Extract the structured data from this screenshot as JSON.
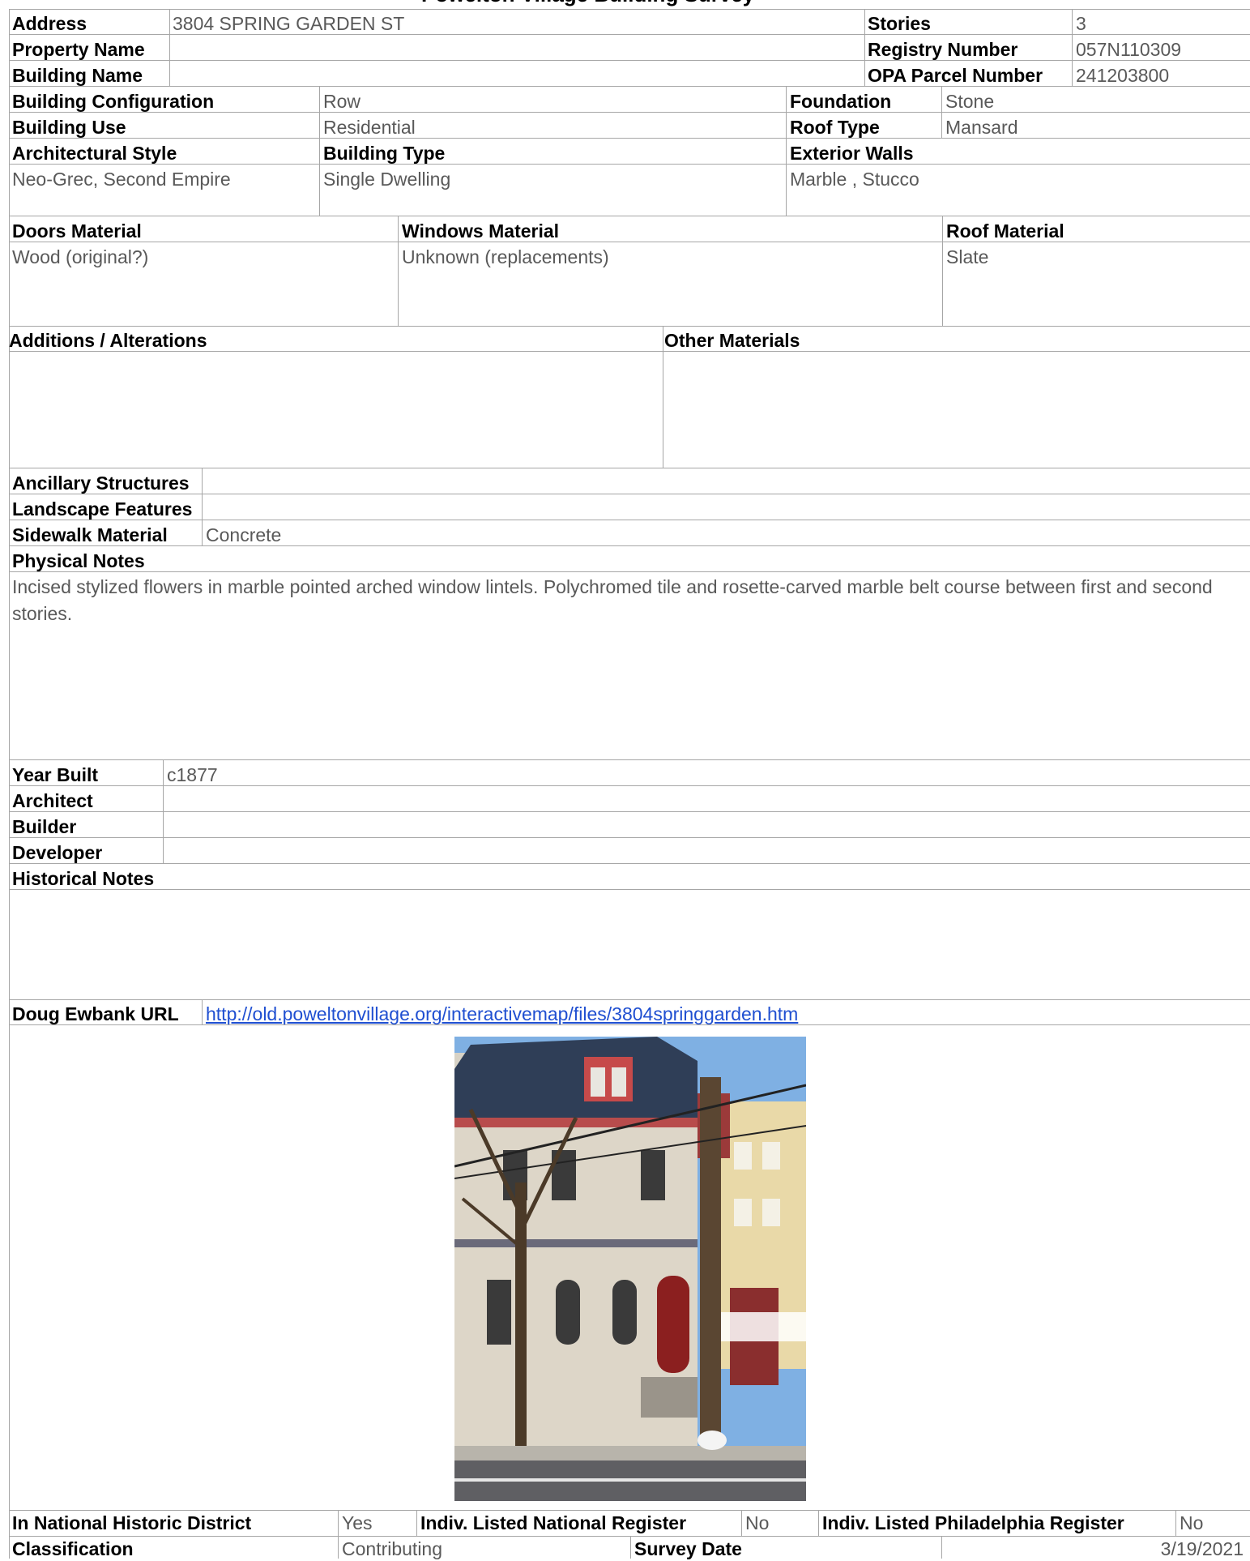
{
  "header": {
    "title": "Powelton Village Building Survey"
  },
  "property": {
    "address_label": "Address",
    "address": "3804 SPRING GARDEN ST",
    "property_name_label": "Property Name",
    "property_name": "",
    "building_name_label": "Building Name",
    "building_name": "",
    "stories_label": "Stories",
    "stories": "3",
    "registry_label": "Registry Number",
    "registry": "057N110309",
    "opa_label": "OPA Parcel Number",
    "opa": "241203800"
  },
  "building": {
    "config_label": "Building Configuration",
    "config": "Row",
    "use_label": "Building Use",
    "use": "Residential",
    "foundation_label": "Foundation",
    "foundation": "Stone",
    "roof_type_label": "Roof Type",
    "roof_type": "Mansard",
    "arch_style_label": "Architectural Style",
    "arch_style": "Neo-Grec, Second Empire",
    "building_type_label": "Building Type",
    "building_type": "Single Dwelling",
    "exterior_walls_label": "Exterior Walls",
    "exterior_walls": "Marble , Stucco"
  },
  "materials": {
    "doors_label": "Doors Material",
    "doors": "Wood (original?)",
    "windows_label": "Windows Material",
    "windows": "Unknown (replacements)",
    "roof_label": "Roof Material",
    "roof": "Slate",
    "additions_label": "Additions / Alterations",
    "additions": "",
    "other_label": "Other Materials",
    "other": ""
  },
  "site": {
    "ancillary_label": "Ancillary Structures",
    "ancillary": "",
    "landscape_label": "Landscape Features",
    "landscape": "",
    "sidewalk_label": "Sidewalk Material",
    "sidewalk": "Concrete",
    "physical_notes_label": "Physical Notes",
    "physical_notes": "Incised stylized flowers in marble pointed arched window lintels. Polychromed tile and rosette-carved marble belt course between first and second stories."
  },
  "history": {
    "year_label": "Year Built",
    "year": "c1877",
    "architect_label": "Architect",
    "architect": "",
    "builder_label": "Builder",
    "builder": "",
    "developer_label": "Developer",
    "developer": "",
    "historical_notes_label": "Historical Notes",
    "historical_notes": ""
  },
  "links": {
    "ewbank_label": "Doug Ewbank URL",
    "ewbank_url": "http://old.poweltonvillage.org/interactivemap/files/3804springgarden.htm"
  },
  "status": {
    "nat_district_label": "In National Historic District",
    "nat_district": "Yes",
    "nat_register_label": "Indiv. Listed National Register",
    "nat_register": "No",
    "phila_register_label": "Indiv. Listed Philadelphia Register",
    "phila_register": "No",
    "classification_label": "Classification",
    "classification": "Contributing",
    "survey_date_label": "Survey Date",
    "survey_date": "3/19/2021"
  },
  "colors": {
    "label": "#000000",
    "value": "#595959",
    "rule": "#a6a6a6",
    "link": "#1f4fd1"
  }
}
